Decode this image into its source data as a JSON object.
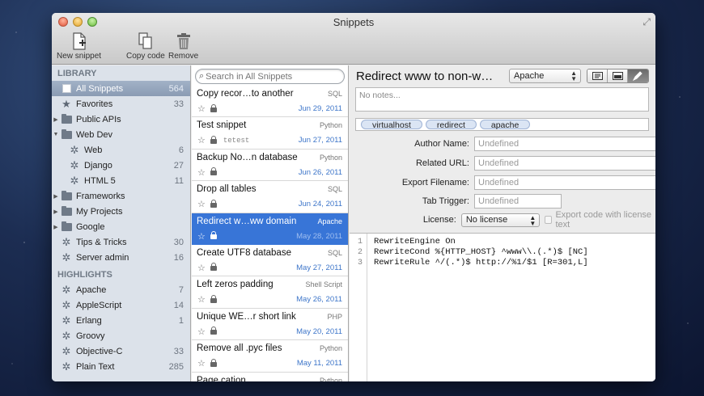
{
  "window": {
    "title": "Snippets"
  },
  "toolbar": {
    "new_snippet": "New snippet",
    "copy_code": "Copy code",
    "remove": "Remove"
  },
  "sidebar": {
    "library_header": "LIBRARY",
    "library": [
      {
        "label": "All Snippets",
        "count": "564",
        "icon": "checkbox-icon",
        "selected": true
      },
      {
        "label": "Favorites",
        "count": "33",
        "icon": "star-icon"
      },
      {
        "label": "Public APIs",
        "count": "",
        "icon": "folder-icon",
        "disclosure": "▶"
      },
      {
        "label": "Web Dev",
        "count": "",
        "icon": "folder-icon",
        "disclosure": "▼"
      },
      {
        "label": "Web",
        "count": "6",
        "icon": "gear-icon",
        "indent": true
      },
      {
        "label": "Django",
        "count": "27",
        "icon": "gear-icon",
        "indent": true
      },
      {
        "label": "HTML 5",
        "count": "11",
        "icon": "gear-icon",
        "indent": true
      },
      {
        "label": "Frameworks",
        "count": "",
        "icon": "folder-icon",
        "disclosure": "▶"
      },
      {
        "label": "My Projects",
        "count": "",
        "icon": "folder-icon",
        "disclosure": "▶"
      },
      {
        "label": "Google",
        "count": "",
        "icon": "folder-icon",
        "disclosure": "▶"
      },
      {
        "label": "Tips & Tricks",
        "count": "30",
        "icon": "gear-icon"
      },
      {
        "label": "Server admin",
        "count": "16",
        "icon": "gear-icon"
      }
    ],
    "highlights_header": "HIGHLIGHTS",
    "highlights": [
      {
        "label": "Apache",
        "count": "7"
      },
      {
        "label": "AppleScript",
        "count": "14"
      },
      {
        "label": "Erlang",
        "count": "1"
      },
      {
        "label": "Groovy",
        "count": ""
      },
      {
        "label": "Objective-C",
        "count": "33"
      },
      {
        "label": "Plain Text",
        "count": "285"
      }
    ]
  },
  "search": {
    "placeholder": "Search in All Snippets"
  },
  "snippets": [
    {
      "name": "Copy recor…to another",
      "lang": "SQL",
      "date": "Jun 29, 2011",
      "tag": ""
    },
    {
      "name": "Test snippet",
      "lang": "Python",
      "date": "Jun 27, 2011",
      "tag": "tetest"
    },
    {
      "name": "Backup No…n database",
      "lang": "Python",
      "date": "Jun 26, 2011",
      "tag": ""
    },
    {
      "name": "Drop all tables",
      "lang": "SQL",
      "date": "Jun 24, 2011",
      "tag": ""
    },
    {
      "name": "Redirect w…ww domain",
      "lang": "Apache",
      "date": "May 28, 2011",
      "tag": "",
      "selected": true
    },
    {
      "name": "Create UTF8 database",
      "lang": "SQL",
      "date": "May 27, 2011",
      "tag": ""
    },
    {
      "name": "Left zeros padding",
      "lang": "Shell Script",
      "date": "May 26, 2011",
      "tag": ""
    },
    {
      "name": "Unique WE…r short link",
      "lang": "PHP",
      "date": "May 20, 2011",
      "tag": ""
    },
    {
      "name": "Remove all .pyc files",
      "lang": "Python",
      "date": "May 11, 2011",
      "tag": ""
    },
    {
      "name": "Page cation",
      "lang": "Python",
      "date": "",
      "tag": ""
    }
  ],
  "detail": {
    "title": "Redirect www to non-w…",
    "language": "Apache",
    "notes_placeholder": "No notes...",
    "tags": [
      "virtualhost",
      "redirect",
      "apache"
    ],
    "fields": {
      "author_label": "Author Name:",
      "author_value": "Undefined",
      "url_label": "Related URL:",
      "url_value": "Undefined",
      "export_label": "Export Filename:",
      "export_value": "Undefined",
      "trigger_label": "Tab Trigger:",
      "trigger_value": "Undefined",
      "license_label": "License:",
      "license_value": "No license",
      "export_license_label": "Export code with license text"
    },
    "code": {
      "line_numbers": [
        "1",
        "2",
        "3"
      ],
      "lines": [
        "RewriteEngine On",
        "RewriteCond %{HTTP_HOST} ^www\\\\.(.*)$ [NC]",
        "RewriteRule ^/(.*)$ http://%1/$1 [R=301,L]"
      ]
    }
  }
}
